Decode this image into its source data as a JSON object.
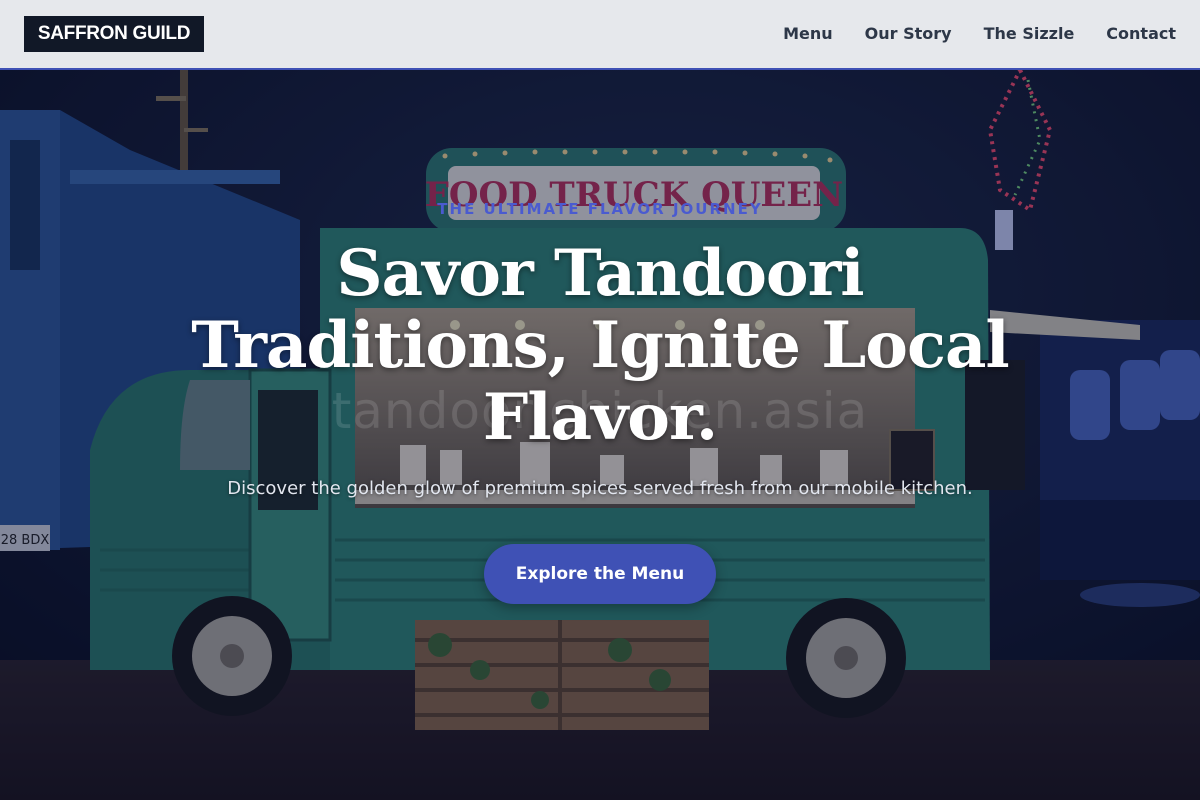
{
  "header": {
    "logo": "SAFFRON GUILD",
    "nav": [
      {
        "label": "Menu"
      },
      {
        "label": "Our Story"
      },
      {
        "label": "The Sizzle"
      },
      {
        "label": "Contact"
      }
    ]
  },
  "hero": {
    "eyebrow": "THE ULTIMATE FLAVOR JOURNEY",
    "headline": "Savor Tandoori Traditions, Ignite Local Flavor.",
    "subtitle": "Discover the golden glow of premium spices served fresh from our mobile kitchen.",
    "cta_label": "Explore the Menu",
    "truck_sign": "FOOD TRUCK QUEEN",
    "watermark": "tandoorichicken.asia",
    "plate": "28 BDX"
  },
  "colors": {
    "accent": "#3f51b5",
    "logo_bg": "#111827",
    "header_bg": "#e6e8ec",
    "truck_green": "#2f8a78"
  }
}
